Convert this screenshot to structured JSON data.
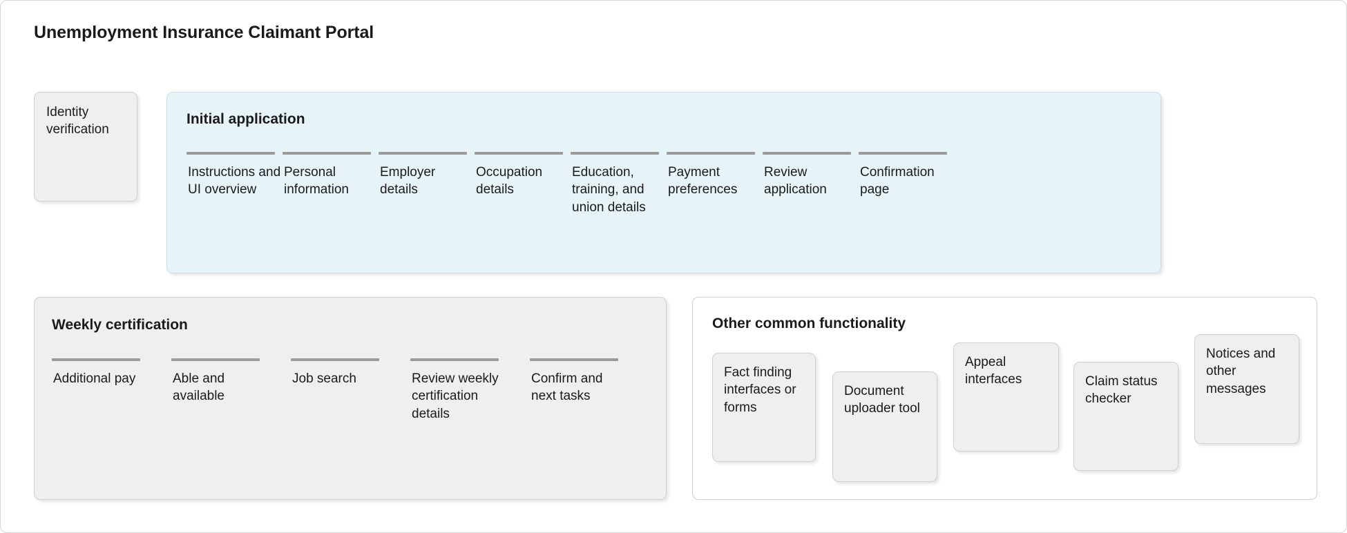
{
  "title": "Unemployment Insurance Claimant Portal",
  "identity": {
    "label": "Identity verification"
  },
  "initial_application": {
    "heading": "Initial application",
    "steps": [
      {
        "label": "Instructions and UI overview"
      },
      {
        "label": "Personal information"
      },
      {
        "label": "Employer details"
      },
      {
        "label": "Occupation details"
      },
      {
        "label": "Education, training, and union details"
      },
      {
        "label": "Payment preferences"
      },
      {
        "label": "Review application"
      },
      {
        "label": "Confirmation page"
      }
    ]
  },
  "weekly_certification": {
    "heading": "Weekly certification",
    "steps": [
      {
        "label": "Additional pay"
      },
      {
        "label": "Able and available"
      },
      {
        "label": "Job search"
      },
      {
        "label": "Review weekly certification details"
      },
      {
        "label": "Confirm and next tasks"
      }
    ]
  },
  "other_common_functionality": {
    "heading": "Other common functionality",
    "cards": [
      {
        "label": "Fact finding interfaces or forms"
      },
      {
        "label": "Document uploader tool"
      },
      {
        "label": "Appeal interfaces"
      },
      {
        "label": "Claim status checker"
      },
      {
        "label": "Notices and other messages"
      }
    ]
  },
  "colors": {
    "page_background": "#ffffff",
    "card_background": "#efefef",
    "card_border": "#d0d0d0",
    "initial_panel_background": "#e6f4f8",
    "initial_panel_border": "#c9dde3",
    "step_rule": "#9a9a9a",
    "text": "#1a1a1a"
  }
}
